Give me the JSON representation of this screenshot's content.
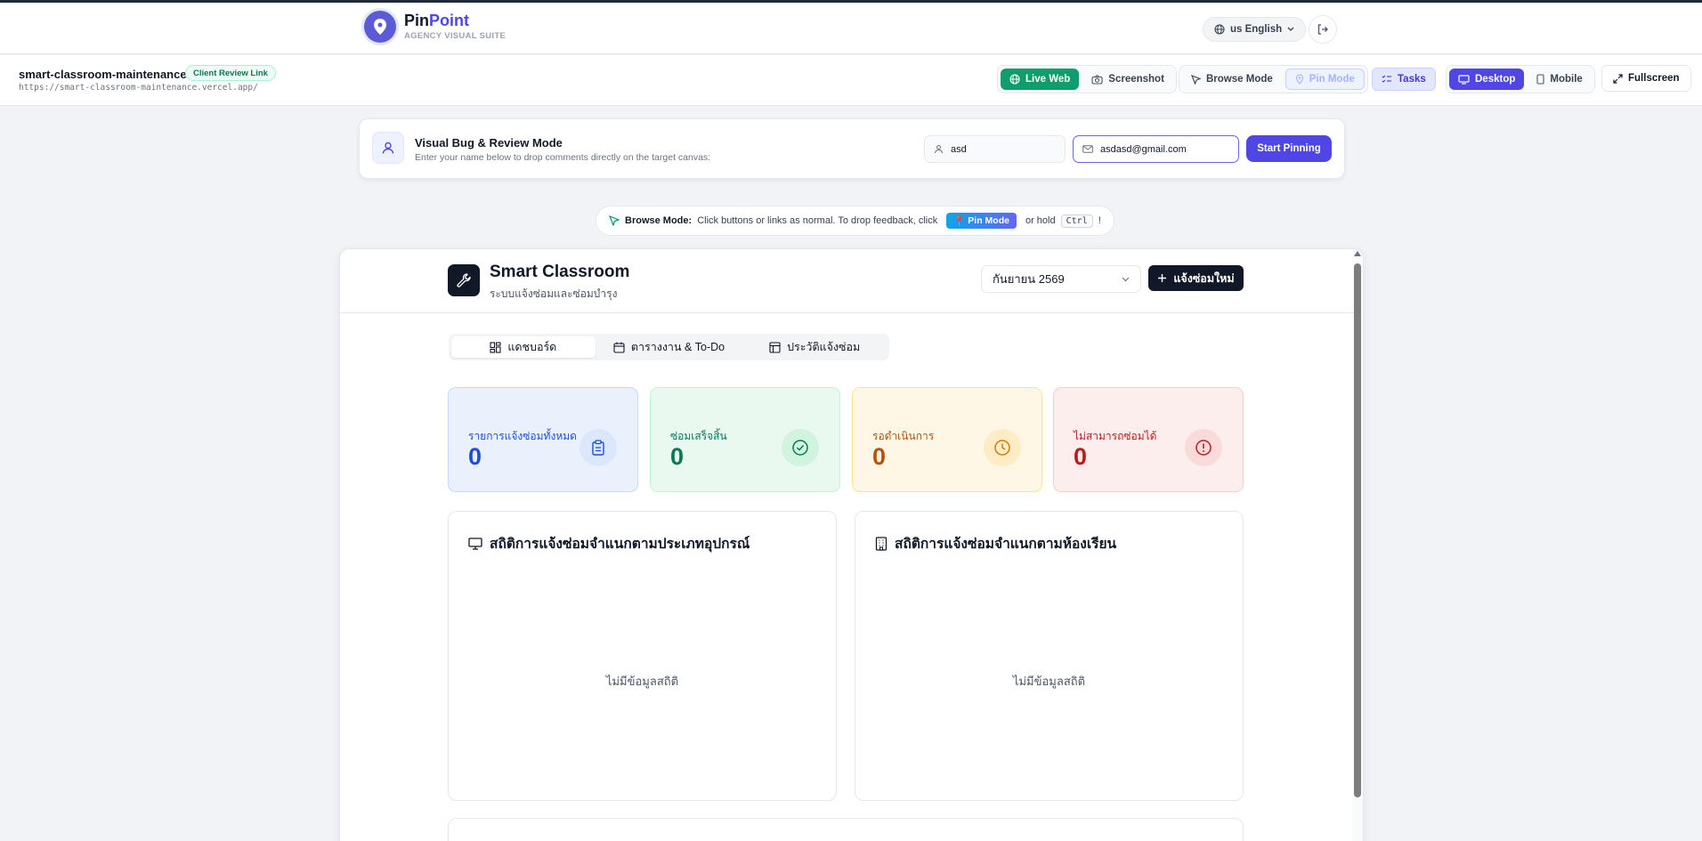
{
  "brand": {
    "name_part1": "Pin",
    "name_part2": "Point",
    "subtitle": "AGENCY VISUAL SUITE"
  },
  "language": {
    "label": "us English"
  },
  "project": {
    "name": "smart-classroom-maintenance",
    "badge": "Client Review Link",
    "url": "https://smart-classroom-maintenance.vercel.app/"
  },
  "toolbar": {
    "live_web": "Live Web",
    "screenshot": "Screenshot",
    "browse_mode": "Browse Mode",
    "pin_mode": "Pin Mode",
    "tasks": "Tasks",
    "desktop": "Desktop",
    "mobile": "Mobile",
    "fullscreen": "Fullscreen"
  },
  "review": {
    "title": "Visual Bug & Review Mode",
    "subtitle": "Enter your name below to drop comments directly on the target canvas:",
    "name_value": "asd",
    "email_value": "asdasd@gmail.com",
    "start_button": "Start Pinning"
  },
  "hint": {
    "label": "Browse Mode:",
    "text": "Click buttons or links as normal. To drop feedback, click",
    "pin_chip": "Pin Mode",
    "or_hold": "or hold",
    "key": "Ctrl",
    "end": "!"
  },
  "app": {
    "title": "Smart Classroom",
    "subtitle": "ระบบแจ้งซ่อมและซ่อมบำรุง",
    "month": "กันยายน 2569",
    "new_button": "แจ้งซ่อมใหม่",
    "tabs": [
      {
        "label": "แดชบอร์ด",
        "icon": "dashboard-icon"
      },
      {
        "label": "ตารางงาน & To-Do",
        "icon": "calendar-icon"
      },
      {
        "label": "ประวัติแจ้งซ่อม",
        "icon": "table-icon"
      }
    ],
    "stats": [
      {
        "label": "รายการแจ้งซ่อมทั้งหมด",
        "value": "0",
        "icon": "clipboard-icon",
        "color": "#1d4ed8"
      },
      {
        "label": "ซ่อมเสร็จสิ้น",
        "value": "0",
        "icon": "check-circle-icon",
        "color": "#047857"
      },
      {
        "label": "รอดำเนินการ",
        "value": "0",
        "icon": "clock-icon",
        "color": "#b45309"
      },
      {
        "label": "ไม่สามารถซ่อมได้",
        "value": "0",
        "icon": "alert-circle-icon",
        "color": "#b91c1c"
      }
    ],
    "panels": [
      {
        "title": "สถิติการแจ้งซ่อมจำแนกตามประเภทอุปกรณ์",
        "empty": "ไม่มีข้อมูลสถิติ",
        "icon": "monitor-icon"
      },
      {
        "title": "สถิติการแจ้งซ่อมจำแนกตามห้องเรียน",
        "empty": "ไม่มีข้อมูลสถิติ",
        "icon": "building-icon"
      }
    ]
  }
}
